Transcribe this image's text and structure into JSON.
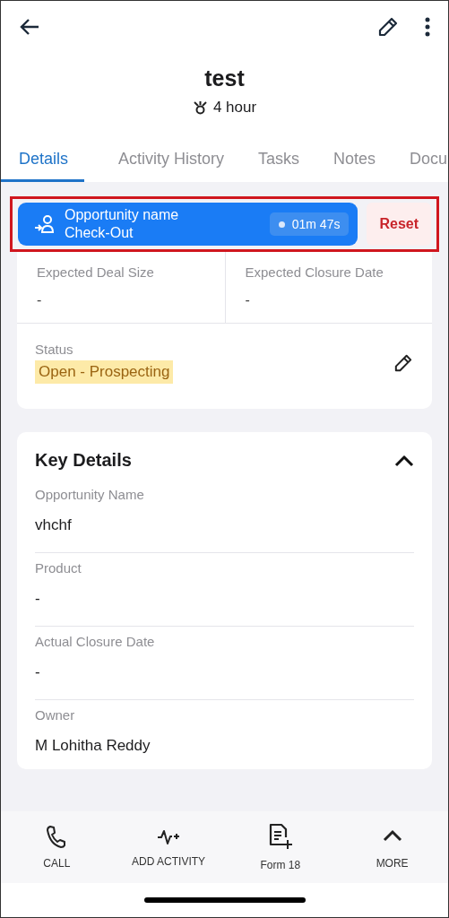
{
  "header": {
    "title": "test",
    "subtitle": "4 hour"
  },
  "tabs": [
    {
      "label": "Details",
      "selected": true
    },
    {
      "label": "Activity History",
      "selected": false
    },
    {
      "label": "Tasks",
      "selected": false
    },
    {
      "label": "Notes",
      "selected": false
    },
    {
      "label": "Docu",
      "selected": false
    }
  ],
  "checkout_banner": {
    "line_1": "Opportunity name",
    "line_2": "Check-Out",
    "timer": "01m 47s",
    "reset": "Reset",
    "highlighted": true
  },
  "summary": {
    "fields": [
      {
        "label": "Expected Deal Size",
        "value": "-"
      },
      {
        "label": "Expected Closure Date",
        "value": "-"
      }
    ],
    "status": {
      "label": "Status",
      "value": "Open - Prospecting"
    }
  },
  "key_details": {
    "title": "Key Details",
    "expanded": true,
    "fields": [
      {
        "label": "Opportunity Name",
        "value": "vhchf"
      },
      {
        "label": "Product",
        "value": "-"
      },
      {
        "label": "Actual Closure Date",
        "value": "-"
      },
      {
        "label": "Owner",
        "value": "M Lohitha Reddy"
      }
    ]
  },
  "bottom_bar": [
    {
      "kind": "call",
      "label": "CALL"
    },
    {
      "kind": "activity",
      "label": "ADD ACTIVITY"
    },
    {
      "kind": "form",
      "label": "Form 18"
    },
    {
      "kind": "more",
      "label": "MORE"
    }
  ]
}
